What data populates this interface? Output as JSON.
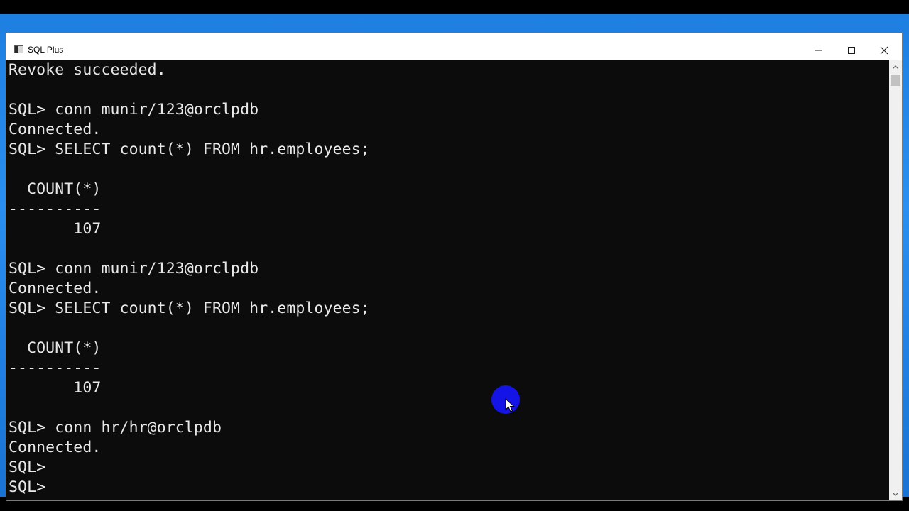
{
  "window": {
    "title": "SQL Plus",
    "icon": "sqlplus-console-icon"
  },
  "caption_buttons": {
    "minimize_icon": "minimize-icon",
    "maximize_icon": "maximize-icon",
    "close_icon": "close-icon"
  },
  "console": {
    "lines": [
      "Revoke succeeded.",
      "",
      "SQL> conn munir/123@orclpdb",
      "Connected.",
      "SQL> SELECT count(*) FROM hr.employees;",
      "",
      "  COUNT(*)",
      "----------",
      "       107",
      "",
      "SQL> conn munir/123@orclpdb",
      "Connected.",
      "SQL> SELECT count(*) FROM hr.employees;",
      "",
      "  COUNT(*)",
      "----------",
      "       107",
      "",
      "SQL> conn hr/hr@orclpdb",
      "Connected.",
      "SQL>",
      "SQL>"
    ]
  },
  "colors": {
    "console_background": "#0c0c0c",
    "console_text": "#e8e8e8",
    "cursor_highlight": "#1414e6",
    "desktop": "#1e7fe0"
  }
}
